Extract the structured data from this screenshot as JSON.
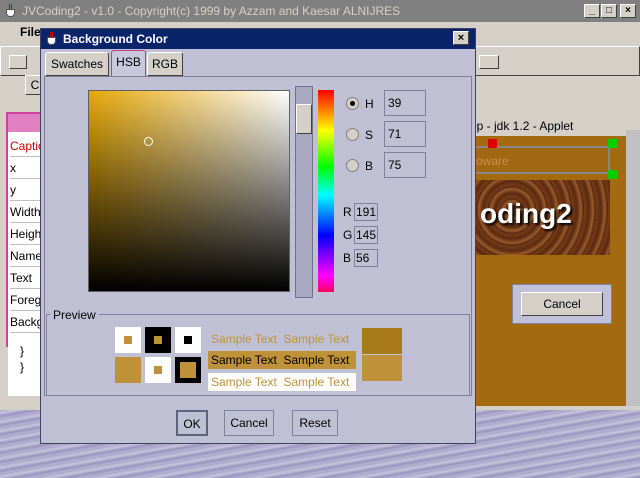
{
  "main_window": {
    "title": "JVCoding2 - v1.0 - Copyright(c) 1999 by Azzam and Kaesar ALNIJRES",
    "menu_first": "File",
    "toolbar_button": "C"
  },
  "properties_panel": {
    "rows": [
      "Captio",
      "x",
      "y",
      "Width",
      "Heigh",
      "Name",
      "Text",
      "Foreg",
      "Backg"
    ]
  },
  "code_area": {
    "lines": [
      "}",
      "}"
    ]
  },
  "applet_window": {
    "title": "op - jdk 1.2 - Applet",
    "textfield_text": "oware",
    "banner_text": "oding2",
    "cancel_label": "Cancel"
  },
  "dialog": {
    "title": "Background Color",
    "tabs": [
      "Swatches",
      "HSB",
      "RGB"
    ],
    "selected_tab": "HSB",
    "hsb": {
      "selected": "H",
      "rows": [
        {
          "label": "H",
          "value": "39"
        },
        {
          "label": "S",
          "value": "71"
        },
        {
          "label": "B",
          "value": "75"
        }
      ]
    },
    "rgb": [
      {
        "label": "R",
        "value": "191"
      },
      {
        "label": "G",
        "value": "145"
      },
      {
        "label": "B",
        "value": "56"
      }
    ],
    "preview": {
      "label": "Preview",
      "sample_text": "Sample Text",
      "color": "#bf9138"
    },
    "buttons": {
      "ok": "OK",
      "cancel": "Cancel",
      "reset": "Reset"
    }
  },
  "icons": [
    "java-cup-icon",
    "close-icon",
    "minimize-icon",
    "maximize-icon"
  ]
}
